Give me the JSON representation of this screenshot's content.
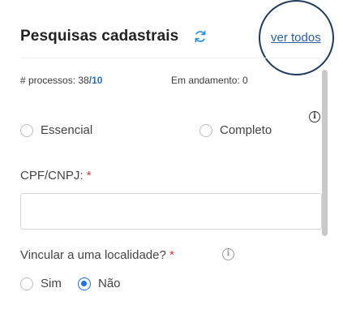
{
  "header": {
    "title": "Pesquisas cadastrais",
    "see_all_label": "ver todos"
  },
  "stats": {
    "processes_label": "# processos: ",
    "processes_used": "38",
    "processes_sep": "/",
    "processes_limit": "10",
    "in_progress": "Em andamento: 0"
  },
  "search_type": {
    "options": [
      "Essencial",
      "Completo"
    ],
    "selected": null
  },
  "cpf_field": {
    "label": "CPF/CNPJ:",
    "required_mark": "*",
    "value": ""
  },
  "locality": {
    "label": "Vincular a uma localidade?",
    "required_mark": "*",
    "options": [
      "Sim",
      "Não"
    ],
    "selected": "Não"
  },
  "icons": {
    "refresh": "refresh-icon",
    "info": "info-icon"
  },
  "colors": {
    "accent": "#2a6fb0",
    "link": "#2a5fa8",
    "radio_selected": "#1f6fe5",
    "required": "#e0313a",
    "annotation": "#1f3a5c"
  }
}
